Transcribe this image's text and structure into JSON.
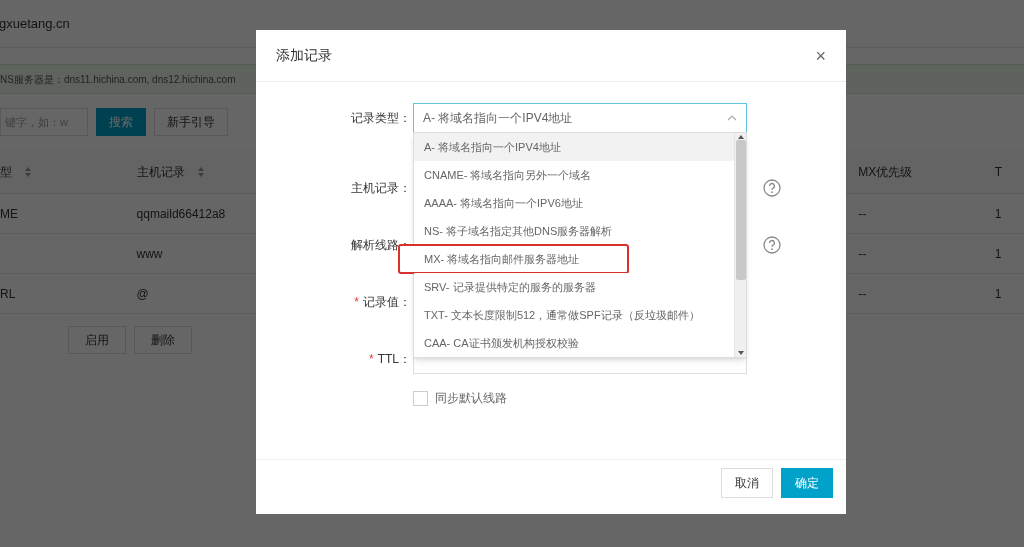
{
  "page": {
    "site": "gxuetang.cn",
    "dns_notice": "NS服务器是：dns11.hichina.com, dns12.hichina.com",
    "search": {
      "placeholder": "键字，如：w"
    },
    "buttons": [
      {
        "label": "搜索",
        "kind": "primary"
      },
      {
        "label": "新手引导",
        "kind": "default"
      }
    ],
    "table": {
      "columns": [
        {
          "label": "型",
          "sortable": true
        },
        {
          "label": "主机记录",
          "sortable": true
        },
        {
          "label": "MX优先级",
          "sortable": false
        },
        {
          "label": "T",
          "sortable": false
        }
      ],
      "rows": [
        [
          "ME",
          "qqmaild66412a8",
          "--",
          "1"
        ],
        [
          "",
          "www",
          "--",
          "1"
        ],
        [
          "RL",
          "@",
          "--",
          "1"
        ]
      ]
    },
    "bulk_buttons": [
      "启用",
      "删除"
    ]
  },
  "dialog": {
    "title": "添加记录",
    "close": "×",
    "fields": [
      {
        "label": "记录类型：",
        "help": false,
        "value": "A- 将域名指向一个IPV4地址",
        "kind": "select"
      },
      {
        "label": "主机记录：",
        "help": true,
        "kind": "input"
      },
      {
        "label": "解析线路：",
        "help": true,
        "kind": "input"
      },
      {
        "label": "记录值：",
        "required_mark": "*",
        "help": false,
        "kind": "input"
      },
      {
        "label": "TTL：",
        "required_mark": "*",
        "help": false,
        "kind": "input"
      }
    ],
    "dropdown": {
      "options": [
        {
          "label": "A- 将域名指向一个IPV4地址",
          "selected": true,
          "outlined": false
        },
        {
          "label": "CNAME- 将域名指向另外一个域名",
          "selected": false,
          "outlined": false
        },
        {
          "label": "AAAA- 将域名指向一个IPV6地址",
          "selected": false,
          "outlined": false
        },
        {
          "label": "NS- 将子域名指定其他DNS服务器解析",
          "selected": false,
          "outlined": false
        },
        {
          "label": "MX- 将域名指向邮件服务器地址",
          "selected": false,
          "outlined": true
        },
        {
          "label": "SRV- 记录提供特定的服务的服务器",
          "selected": false,
          "outlined": false
        },
        {
          "label": "TXT- 文本长度限制512，通常做SPF记录（反垃圾邮件）",
          "selected": false,
          "outlined": false
        },
        {
          "label": "CAA- CA证书颁发机构授权校验",
          "selected": false,
          "outlined": false
        }
      ]
    },
    "checkbox": {
      "label": "同步默认线路",
      "checked": false
    },
    "buttons": [
      {
        "label": "取消",
        "kind": "default"
      },
      {
        "label": "确定",
        "kind": "primary"
      }
    ]
  }
}
